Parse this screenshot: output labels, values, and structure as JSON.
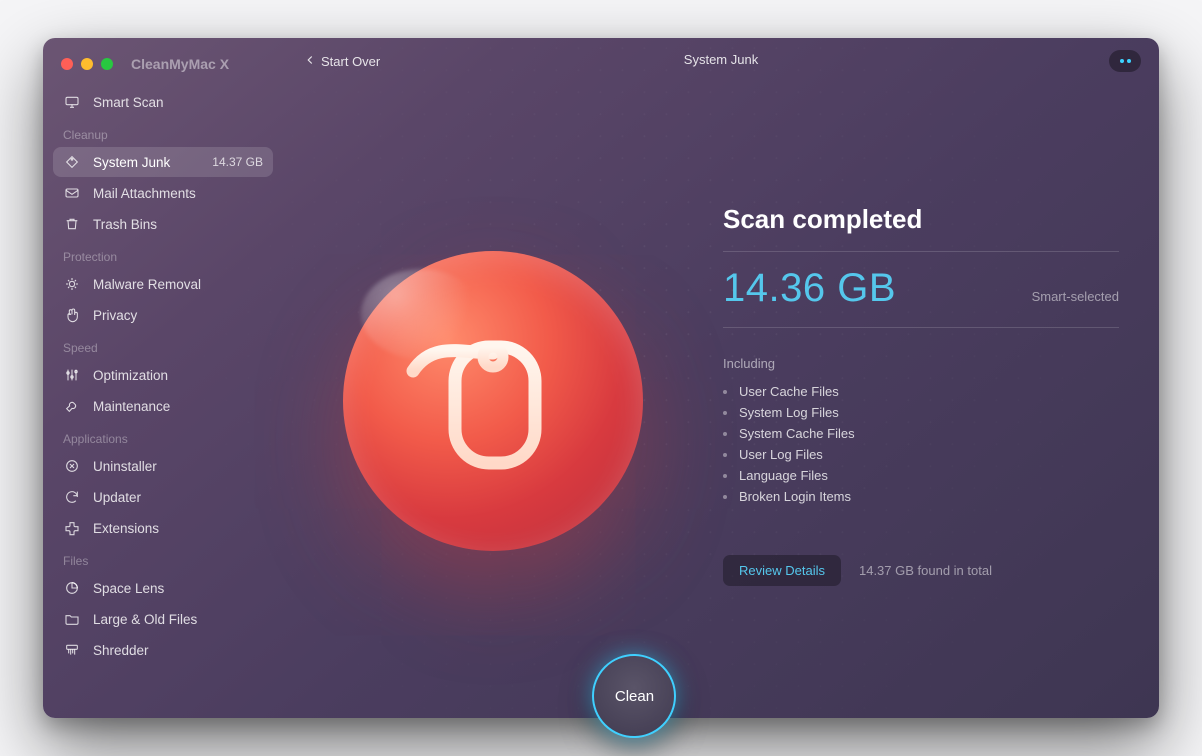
{
  "app": {
    "title": "CleanMyMac X"
  },
  "header": {
    "back_label": "Start Over",
    "center_title": "System Junk"
  },
  "sidebar": {
    "smart_scan": {
      "label": "Smart Scan"
    },
    "sections": [
      {
        "label": "Cleanup",
        "items": [
          {
            "id": "system-junk",
            "label": "System Junk",
            "badge": "14.37 GB",
            "active": true
          },
          {
            "id": "mail-attachments",
            "label": "Mail Attachments"
          },
          {
            "id": "trash-bins",
            "label": "Trash Bins"
          }
        ]
      },
      {
        "label": "Protection",
        "items": [
          {
            "id": "malware-removal",
            "label": "Malware Removal"
          },
          {
            "id": "privacy",
            "label": "Privacy"
          }
        ]
      },
      {
        "label": "Speed",
        "items": [
          {
            "id": "optimization",
            "label": "Optimization"
          },
          {
            "id": "maintenance",
            "label": "Maintenance"
          }
        ]
      },
      {
        "label": "Applications",
        "items": [
          {
            "id": "uninstaller",
            "label": "Uninstaller"
          },
          {
            "id": "updater",
            "label": "Updater"
          },
          {
            "id": "extensions",
            "label": "Extensions"
          }
        ]
      },
      {
        "label": "Files",
        "items": [
          {
            "id": "space-lens",
            "label": "Space Lens"
          },
          {
            "id": "large-old-files",
            "label": "Large & Old Files"
          },
          {
            "id": "shredder",
            "label": "Shredder"
          }
        ]
      }
    ]
  },
  "result": {
    "title": "Scan completed",
    "size": "14.36 GB",
    "smart_selected_label": "Smart-selected",
    "including_label": "Including",
    "includes": [
      "User Cache Files",
      "System Log Files",
      "System Cache Files",
      "User Log Files",
      "Language Files",
      "Broken Login Items"
    ],
    "review_label": "Review Details",
    "found_total": "14.37 GB found in total"
  },
  "action": {
    "clean_label": "Clean"
  }
}
